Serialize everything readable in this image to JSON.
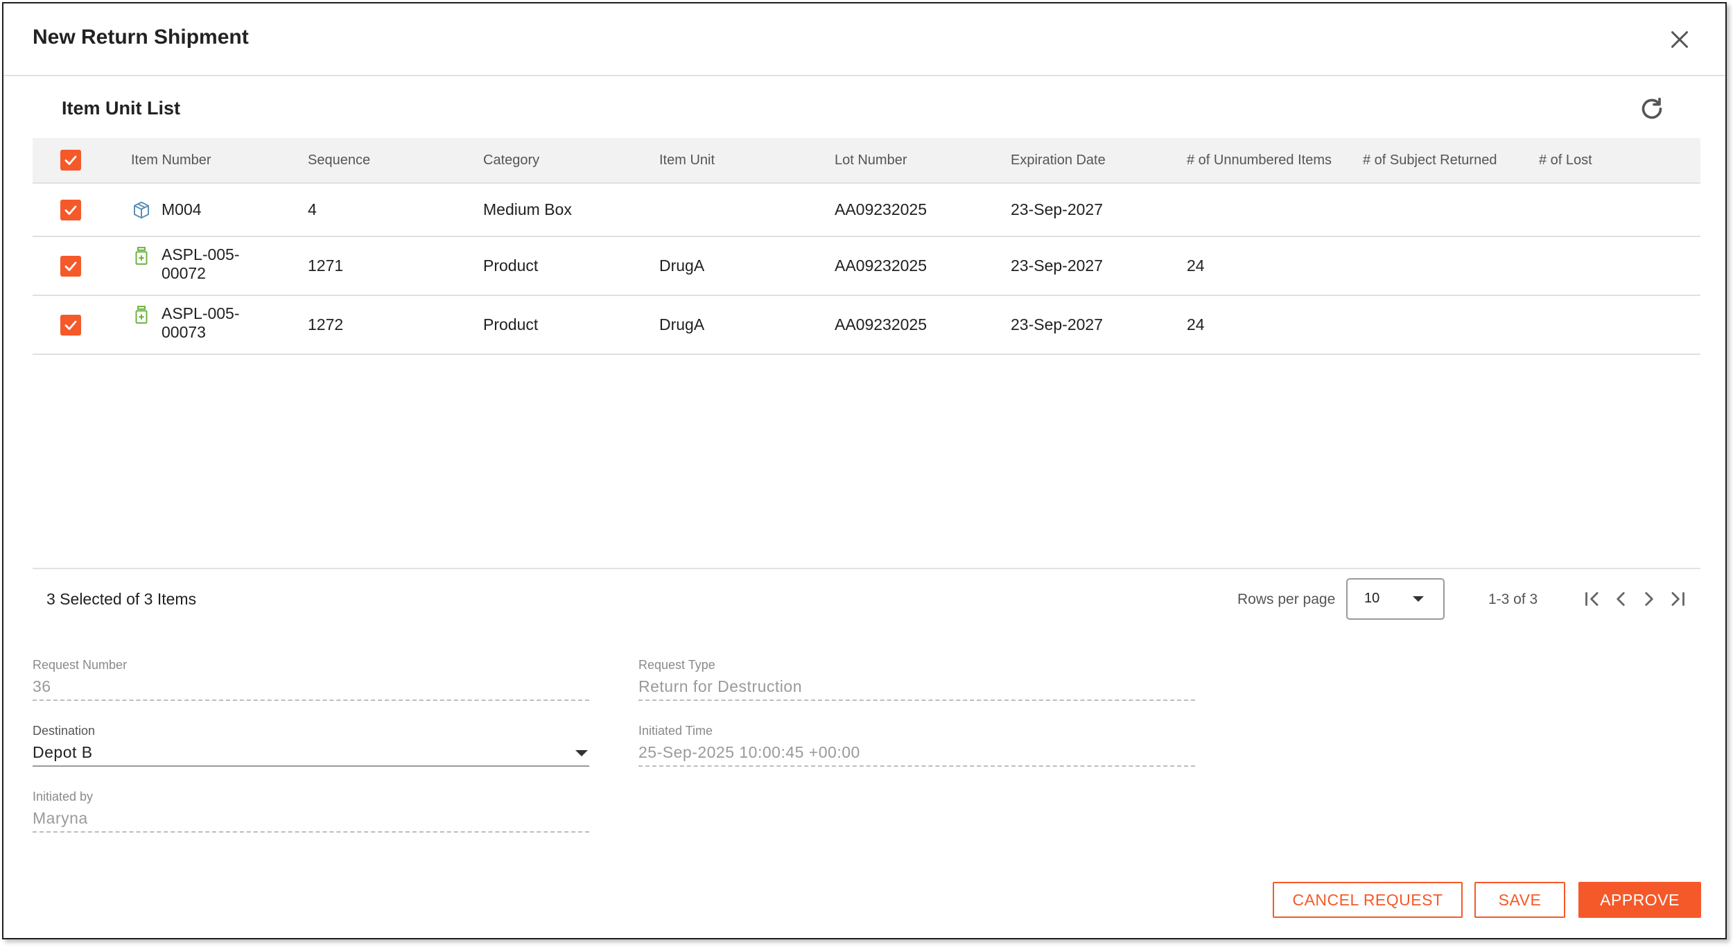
{
  "dialog": {
    "title": "New Return Shipment"
  },
  "section": {
    "title": "Item Unit List"
  },
  "table": {
    "headers": {
      "item_number": "Item Number",
      "sequence": "Sequence",
      "category": "Category",
      "item_unit": "Item Unit",
      "lot_number": "Lot Number",
      "expiration_date": "Expiration Date",
      "unnumbered_items": "# of Unnumbered Items",
      "subject_returned": "# of Subject Returned",
      "lost": "# of Lost"
    },
    "rows": [
      {
        "icon": "box-icon",
        "item_number": "M004",
        "sequence": "4",
        "category": "Medium Box",
        "item_unit": "",
        "lot_number": "AA09232025",
        "expiration_date": "23-Sep-2027",
        "unnumbered_items": "",
        "subject_returned": "",
        "lost": ""
      },
      {
        "icon": "medicine-bottle-icon",
        "item_number": "ASPL-005-00072",
        "sequence": "1271",
        "category": "Product",
        "item_unit": "DrugA",
        "lot_number": "AA09232025",
        "expiration_date": "23-Sep-2027",
        "unnumbered_items": "24",
        "subject_returned": "",
        "lost": ""
      },
      {
        "icon": "medicine-bottle-icon",
        "item_number": "ASPL-005-00073",
        "sequence": "1272",
        "category": "Product",
        "item_unit": "DrugA",
        "lot_number": "AA09232025",
        "expiration_date": "23-Sep-2027",
        "unnumbered_items": "24",
        "subject_returned": "",
        "lost": ""
      }
    ]
  },
  "footer": {
    "selected_text": "3 Selected of 3 Items",
    "rows_per_page_label": "Rows per page",
    "rows_per_page_value": "10",
    "range_text": "1-3 of 3"
  },
  "form": {
    "request_number_label": "Request Number",
    "request_number_value": "36",
    "request_type_label": "Request Type",
    "request_type_value": "Return for Destruction",
    "destination_label": "Destination",
    "destination_value": "Depot B",
    "initiated_time_label": "Initiated Time",
    "initiated_time_value": "25-Sep-2025 10:00:45 +00:00",
    "initiated_by_label": "Initiated by",
    "initiated_by_value": "Maryna"
  },
  "actions": {
    "cancel_label": "CANCEL REQUEST",
    "save_label": "SAVE",
    "approve_label": "APPROVE"
  },
  "colors": {
    "accent": "#f5592a",
    "box_icon": "#5b8fb9",
    "product_icon": "#6cb33f"
  }
}
